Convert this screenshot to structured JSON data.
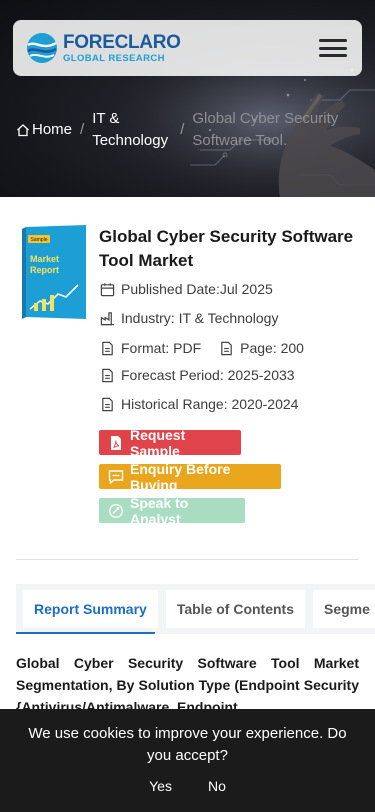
{
  "brand": {
    "name": "FORECLARO",
    "tagline": "GLOBAL RESEARCH",
    "primary_color": "#1c5a9e",
    "secondary_color": "#1e9fd3"
  },
  "breadcrumb": {
    "home": "Home",
    "category": "IT & Technology",
    "current": "Global Cyber Security Software Tool."
  },
  "report": {
    "cover": {
      "tag": "Sample",
      "title_line1": "Market",
      "title_line2": "Report"
    },
    "title": "Global Cyber Security Software Tool Market",
    "published": "Published Date:Jul 2025",
    "industry": "Industry: IT & Technology",
    "format": "Format: PDF",
    "pages": "Page: 200",
    "forecast": "Forecast Period: 2025-2033",
    "historical": "Historical Range: 2020-2024"
  },
  "actions": {
    "request_sample": "Request Sample",
    "enquiry": "Enquiry Before Buying",
    "speak": "Speak to Analyst",
    "colors": {
      "sample": "#e0444a",
      "enquiry": "#e9a51c",
      "speak": "#a9dcc0"
    }
  },
  "tabs": [
    {
      "label": "Report Summary",
      "active": true
    },
    {
      "label": "Table of Contents",
      "active": false
    },
    {
      "label": "Segme",
      "active": false
    }
  ],
  "summary": "Global Cyber Security Software Tool Market Segmentation, By Solution Type (Endpoint Security {Antivirus/Antimalware, Endpoint",
  "cookie": {
    "message": "We use cookies to improve your experience. Do you accept?",
    "yes": "Yes",
    "no": "No"
  }
}
